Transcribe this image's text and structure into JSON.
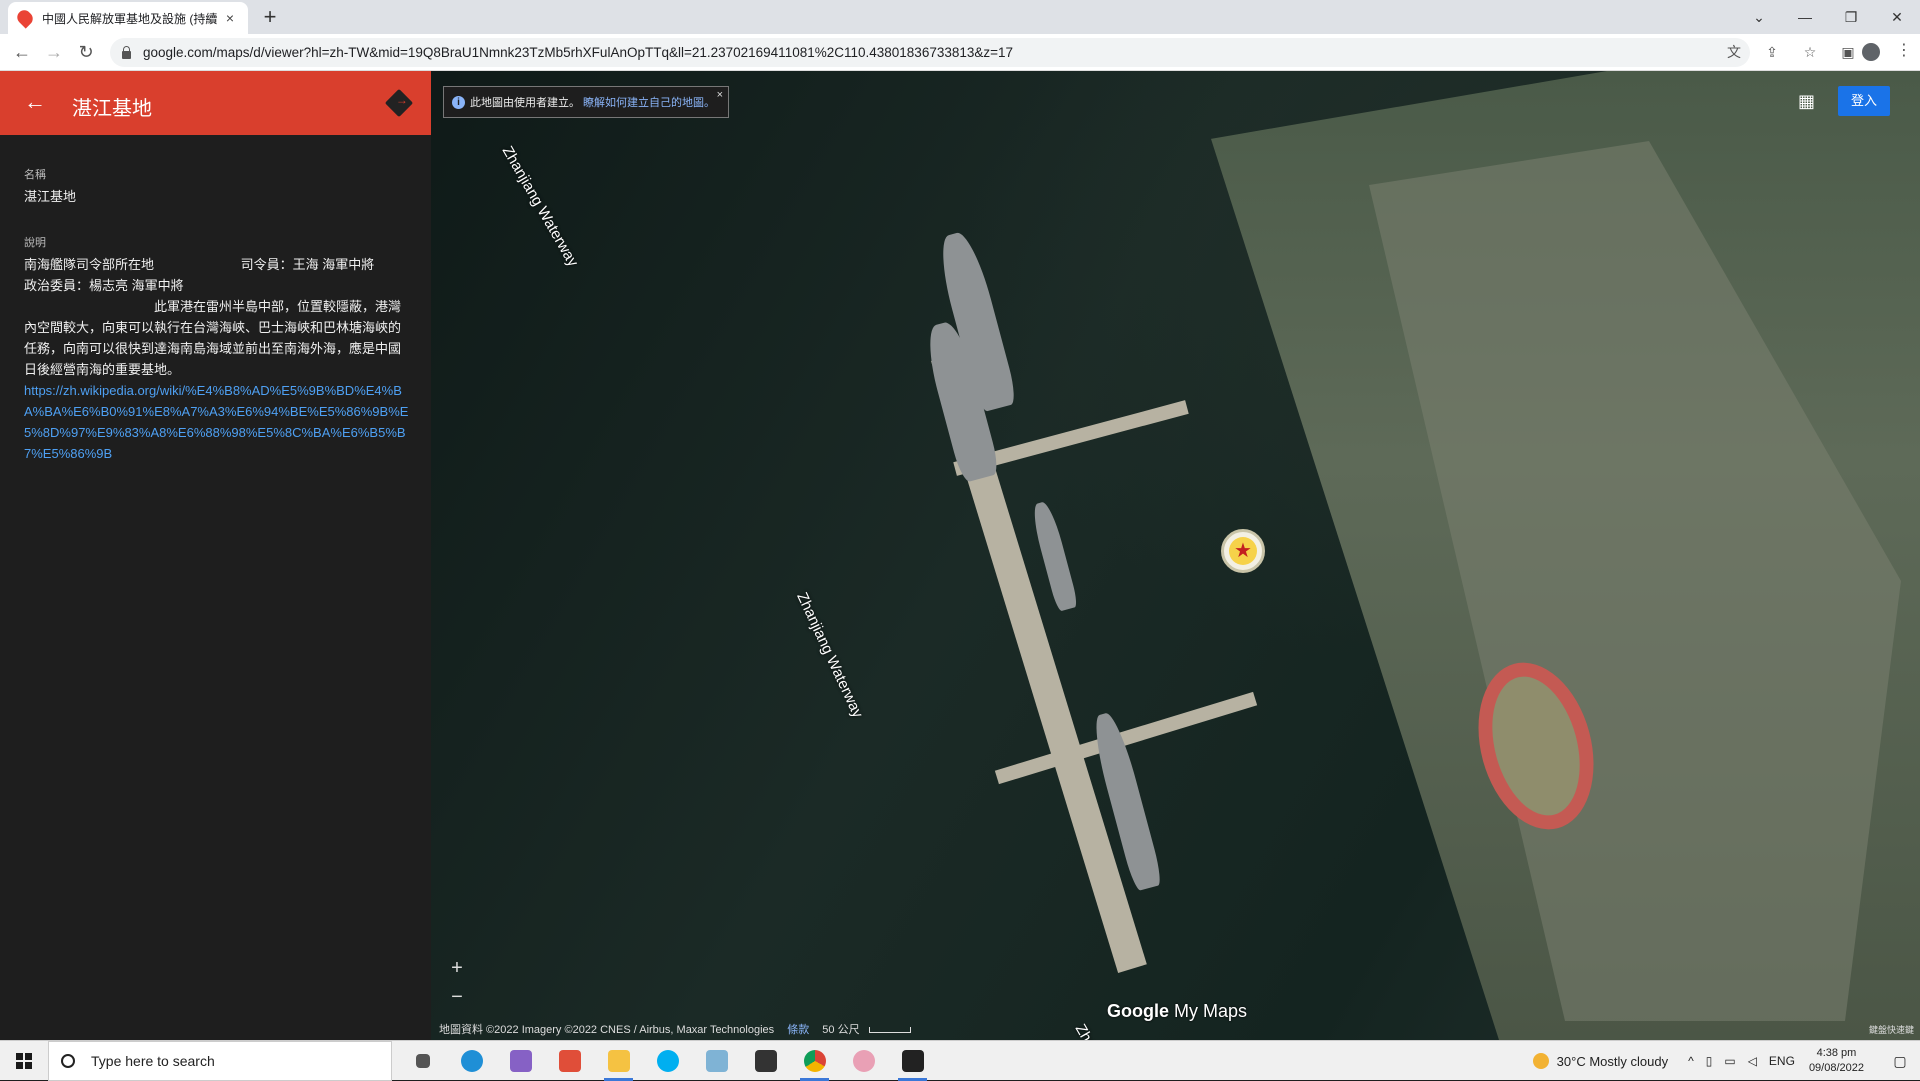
{
  "browser": {
    "tab_title": "中國人民解放軍基地及設施 (持續",
    "tab_close": "×",
    "new_tab": "+",
    "window_controls": [
      "⌄",
      "—",
      "❐",
      "✕"
    ],
    "url": "google.com/maps/d/viewer?hl=zh-TW&mid=19Q8BraU1Nmnk23TzMb5rhXFulAnOpTTq&ll=21.23702169411081%2C110.43801836733813&z=17"
  },
  "sidepanel": {
    "title": "湛江基地",
    "name_label": "名稱",
    "name_value": "湛江基地",
    "desc_label": "說明",
    "description": "南海艦隊司令部所在地                        司令員：王海 海軍中將\n政治委員：楊志亮 海軍中將\n                                    此軍港在雷州半島中部，位置較隱蔽，港灣內空間較大，向東可以執行在台灣海峽、巴士海峽和巴林塘海峽的任務，向南可以很快到達海南島海域並前出至南海外海，應是中國日後經營南海的重要基地。",
    "link": "https://zh.wikipedia.org/wiki/%E4%B8%AD%E5%9B%BD%E4%BA%BA%E6%B0%91%E8%A7%A3%E6%94%BE%E5%86%9B%E5%8D%97%E9%83%A8%E6%88%98%E5%8C%BA%E6%B5%B7%E5%86%9B"
  },
  "map": {
    "info_banner_text": "此地圖由使用者建立。",
    "info_banner_link": "瞭解如何建立自己的地圖。",
    "info_close": "×",
    "signin_label": "登入",
    "water_labels": [
      "Zhanjiang Waterway",
      "Zhanjiang Waterway",
      "Zha"
    ],
    "zoom_in": "+",
    "zoom_out": "−",
    "attribution": "地圖資料 ©2022 Imagery ©2022 CNES / Airbus, Maxar Technologies",
    "terms": "條款",
    "scale": "50 公尺",
    "brand_google": "Google",
    "brand_mymaps": "My Maps",
    "corner_note": "鍵盤快速鍵"
  },
  "taskbar": {
    "search_placeholder": "Type here to search",
    "weather": "30°C  Mostly cloudy",
    "lang": "ENG",
    "time": "4:38 pm",
    "date": "09/08/2022"
  },
  "colors": {
    "header_red": "#d93f2d",
    "link_blue": "#4ea0f3",
    "signin_blue": "#1a73e8"
  }
}
